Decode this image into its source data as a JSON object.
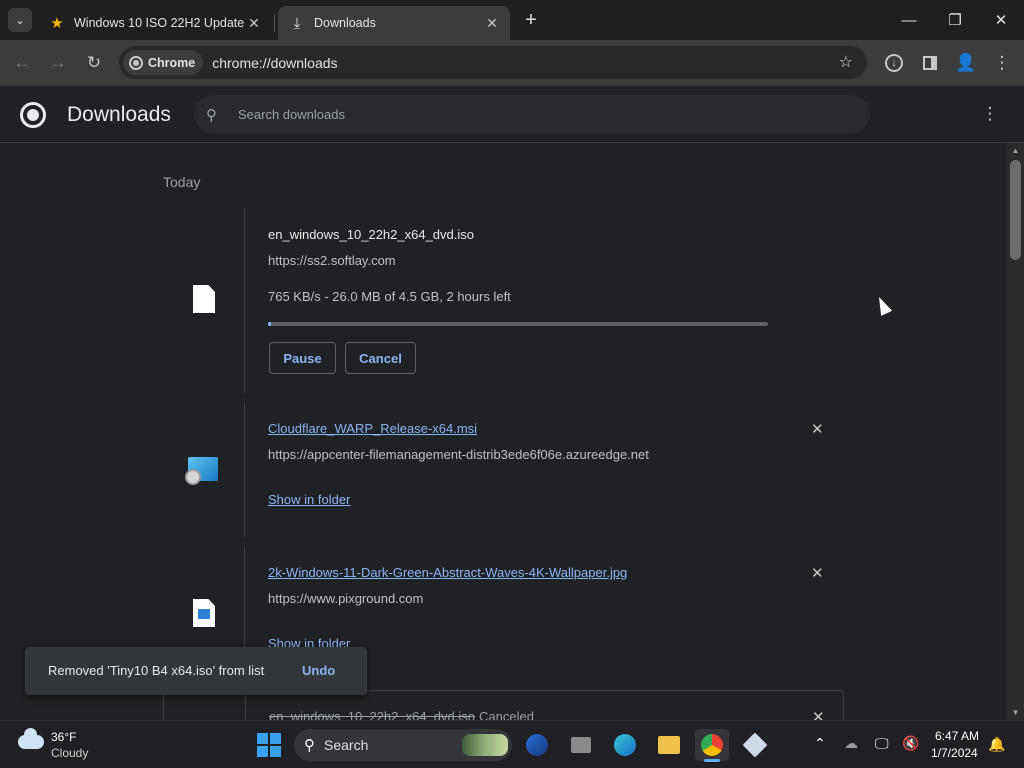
{
  "browser": {
    "tabs": [
      {
        "title": "Windows 10 ISO 22H2 Update",
        "favicon": "star-icon",
        "active": false
      },
      {
        "title": "Downloads",
        "favicon": "download-icon",
        "active": true
      }
    ],
    "chip_label": "Chrome",
    "url": "chrome://downloads"
  },
  "downloads_page": {
    "title": "Downloads",
    "search_placeholder": "Search downloads",
    "section_label": "Today",
    "items": [
      {
        "filename": "en_windows_10_22h2_x64_dvd.iso",
        "source": "https://ss2.softlay.com",
        "status": "765 KB/s - 26.0 MB of 4.5 GB, 2 hours left",
        "progress": 0.006,
        "pause_label": "Pause",
        "cancel_label": "Cancel",
        "icon": "document-icon"
      },
      {
        "filename": "Cloudflare_WARP_Release-x64.msi",
        "source": "https://appcenter-filemanagement-distrib3ede6f06e.azureedge.net",
        "action_label": "Show in folder",
        "icon": "installer-icon"
      },
      {
        "filename": "2k-Windows-11-Dark-Green-Abstract-Waves-4K-Wallpaper.jpg",
        "source": "https://www.pixground.com",
        "action_label": "Show in folder",
        "icon": "image-file-icon"
      },
      {
        "filename": "en_windows_10_22h2_x64_dvd.iso",
        "status_suffix": "Canceled",
        "icon": "document-icon"
      }
    ],
    "toast": {
      "message": "Removed 'Tiny10 B4 x64.iso' from list",
      "undo_label": "Undo"
    }
  },
  "taskbar": {
    "weather_temp": "36°F",
    "weather_desc": "Cloudy",
    "search_label": "Search",
    "time": "6:47 AM",
    "date": "1/7/2024"
  },
  "colors": {
    "accent": "#8ab4f8",
    "background": "#202124",
    "taskbar_accent": "#5fb2f2"
  }
}
